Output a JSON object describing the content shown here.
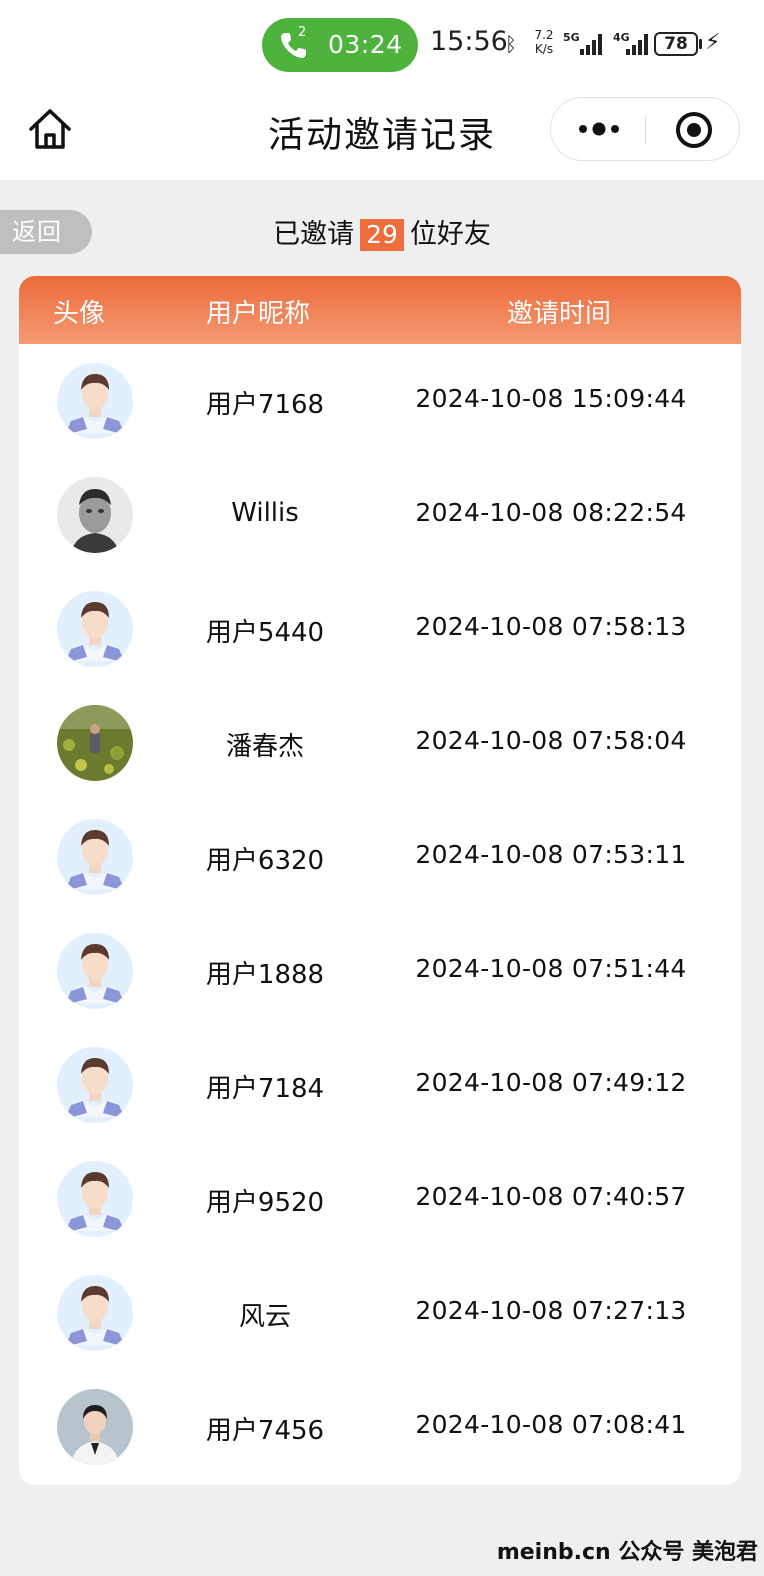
{
  "status_bar": {
    "call_badge": "2",
    "call_time": "03:24",
    "clock": "15:56",
    "net_speed_value": "7.2",
    "net_speed_unit": "K/s",
    "net1": "5G",
    "net2": "4G",
    "battery": "78"
  },
  "nav": {
    "title": "活动邀请记录"
  },
  "back_label": "返回",
  "summary": {
    "prefix": "已邀请",
    "count": "29",
    "suffix": "位好友"
  },
  "table": {
    "headers": {
      "avatar": "头像",
      "nickname": "用户昵称",
      "time": "邀请时间"
    },
    "rows": [
      {
        "avatar": "default",
        "nickname": "用户7168",
        "time": "2024-10-08 15:09:44"
      },
      {
        "avatar": "photo-portrait-bw",
        "nickname": "Willis",
        "time": "2024-10-08 08:22:54"
      },
      {
        "avatar": "default",
        "nickname": "用户5440",
        "time": "2024-10-08 07:58:13"
      },
      {
        "avatar": "photo-field",
        "nickname": "潘春杰",
        "time": "2024-10-08 07:58:04"
      },
      {
        "avatar": "default",
        "nickname": "用户6320",
        "time": "2024-10-08 07:53:11"
      },
      {
        "avatar": "default",
        "nickname": "用户1888",
        "time": "2024-10-08 07:51:44"
      },
      {
        "avatar": "default",
        "nickname": "用户7184",
        "time": "2024-10-08 07:49:12"
      },
      {
        "avatar": "default",
        "nickname": "用户9520",
        "time": "2024-10-08 07:40:57"
      },
      {
        "avatar": "default",
        "nickname": "风云",
        "time": "2024-10-08 07:27:13"
      },
      {
        "avatar": "photo-woman",
        "nickname": "用户7456",
        "time": "2024-10-08 07:08:41"
      }
    ]
  },
  "colors": {
    "accent": "#ee6f3c",
    "call_green": "#4db33d",
    "page_bg": "#efefef"
  },
  "watermark": "meinb.cn  公众号 美泡君"
}
